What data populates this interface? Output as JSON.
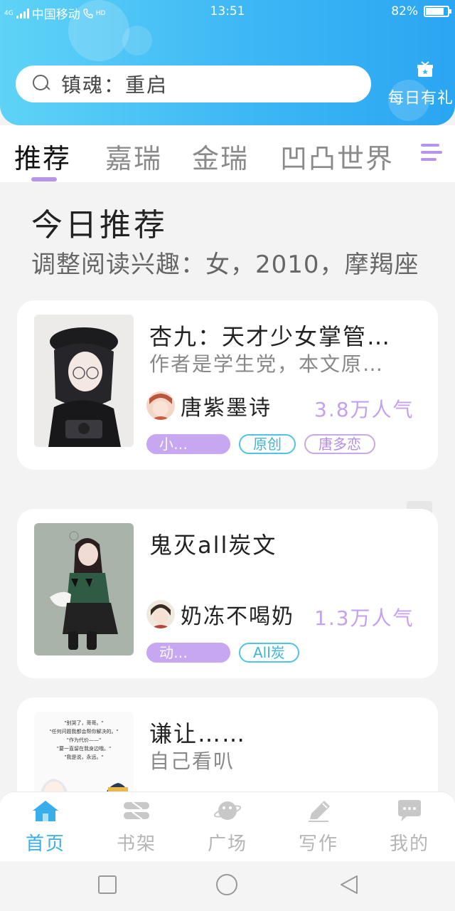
{
  "status_bar": {
    "network": "4G",
    "carrier": "中国移动",
    "hd": "HD",
    "time": "13:51",
    "battery": "82%",
    "battery_level": 0.82
  },
  "search": {
    "placeholder": "镇魂：重启"
  },
  "daily_gift": {
    "label": "每日有礼"
  },
  "tabs": [
    {
      "label": "推荐",
      "active": true
    },
    {
      "label": "嘉瑞",
      "active": false
    },
    {
      "label": "金瑞",
      "active": false
    },
    {
      "label": "凹凸世界",
      "active": false
    }
  ],
  "section": {
    "title": "今日推荐",
    "subtitle": "调整阅读兴趣：女，2010，摩羯座"
  },
  "books": [
    {
      "title": "杏九：天才少女掌管…",
      "description": "作者是学生党，本文原…",
      "author": "唐紫墨诗",
      "popularity": "3.8万人气",
      "tags": [
        {
          "label": "小…",
          "style": "fill"
        },
        {
          "label": "原创",
          "style": "cyan"
        },
        {
          "label": "唐多恋",
          "style": "purple"
        }
      ]
    },
    {
      "title": "鬼灭all炭文",
      "description": "",
      "author": "奶冻不喝奶",
      "popularity": "1.3万人气",
      "tags": [
        {
          "label": "动…",
          "style": "fill"
        },
        {
          "label": "All炭",
          "style": "cyan"
        }
      ]
    },
    {
      "title": "谦让……",
      "description": "自己看叭",
      "author": "",
      "popularity": "",
      "cover_quote": [
        "\"别哭了，哥哥。\"",
        "\"任何问题我都会帮你解决的。\"",
        "\"作为代价——\"",
        "\"要一直留在我身边哦。\"",
        "\"我是说，永远。\""
      ]
    }
  ],
  "bottom_nav": [
    {
      "label": "首页",
      "icon": "home-icon",
      "active": true
    },
    {
      "label": "书架",
      "icon": "bookshelf-icon",
      "active": false
    },
    {
      "label": "广场",
      "icon": "planet-icon",
      "active": false
    },
    {
      "label": "写作",
      "icon": "pen-icon",
      "active": false
    },
    {
      "label": "我的",
      "icon": "chat-bubble-icon",
      "active": false
    }
  ],
  "colors": {
    "header_gradient_start": "#5fd3f6",
    "header_gradient_end": "#2aa6f2",
    "accent_purple": "#b694ee",
    "popularity": "#c4a0f0",
    "tag_cyan": "#4ec4e6",
    "nav_active": "#3aaeea"
  }
}
